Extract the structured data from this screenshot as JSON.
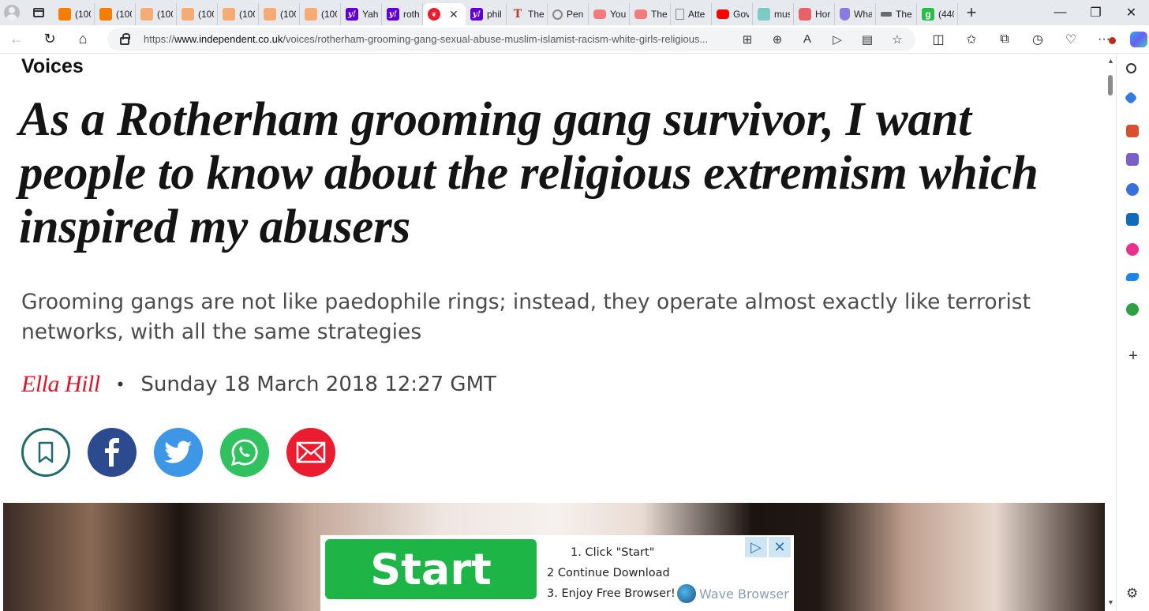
{
  "browser": {
    "tabs": [
      {
        "icon": "blogger",
        "title": "(100"
      },
      {
        "icon": "blogger",
        "title": "(100"
      },
      {
        "icon": "blogger-faded",
        "title": "(100"
      },
      {
        "icon": "blogger-faded",
        "title": "(100"
      },
      {
        "icon": "blogger-faded",
        "title": "(100"
      },
      {
        "icon": "blogger-faded",
        "title": "(100"
      },
      {
        "icon": "blogger-faded",
        "title": "(100"
      },
      {
        "icon": "yahoo",
        "title": "Yah"
      },
      {
        "icon": "yahoo",
        "title": "roth"
      },
      {
        "icon": "independent",
        "title": "",
        "active": true
      },
      {
        "icon": "yahoo",
        "title": "phil"
      },
      {
        "icon": "telegraph",
        "title": "The"
      },
      {
        "icon": "gray-circle",
        "title": "Pen"
      },
      {
        "icon": "youtube-pale",
        "title": "You"
      },
      {
        "icon": "youtube-pale",
        "title": "The"
      },
      {
        "icon": "document",
        "title": "Atte"
      },
      {
        "icon": "youtube",
        "title": "Gov"
      },
      {
        "icon": "teal",
        "title": "mus"
      },
      {
        "icon": "red-mic",
        "title": "Hor"
      },
      {
        "icon": "shield",
        "title": "Wha"
      },
      {
        "icon": "dots",
        "title": "The"
      },
      {
        "icon": "green-g",
        "title": "(440"
      }
    ],
    "url_prefix": "https://",
    "url_domain": "www.independent.co.uk",
    "url_path": "/voices/rotherham-grooming-gang-sexual-abuse-muslim-islamist-racism-white-girls-religious...",
    "close_tab_symbol": "✕",
    "new_tab_symbol": "+"
  },
  "article": {
    "section": "Voices",
    "headline": "As a Rotherham grooming gang survivor, I want people to know about the religious extremism which inspired my abusers",
    "standfirst": "Grooming gangs are not like paedophile rings; instead, they operate almost exactly like terrorist networks, with all the same strategies",
    "author": "Ella Hill",
    "separator": "•",
    "date": "Sunday 18 March 2018 12:27 GMT",
    "share_buttons": [
      "bookmark-icon",
      "facebook-icon",
      "twitter-icon",
      "whatsapp-icon",
      "email-icon"
    ]
  },
  "ad": {
    "button": "Start",
    "step1": "1. Click \"Start\"",
    "step2": "2 Continue Download",
    "step3": "3. Enjoy Free Browser!",
    "brand": "Wave Browser"
  },
  "colors": {
    "accent_red": "#e0132a",
    "ad_green": "#1db545",
    "facebook": "#2b4b8e",
    "twitter": "#3d96e6",
    "whatsapp": "#30c25f",
    "email": "#eb1c2f"
  }
}
